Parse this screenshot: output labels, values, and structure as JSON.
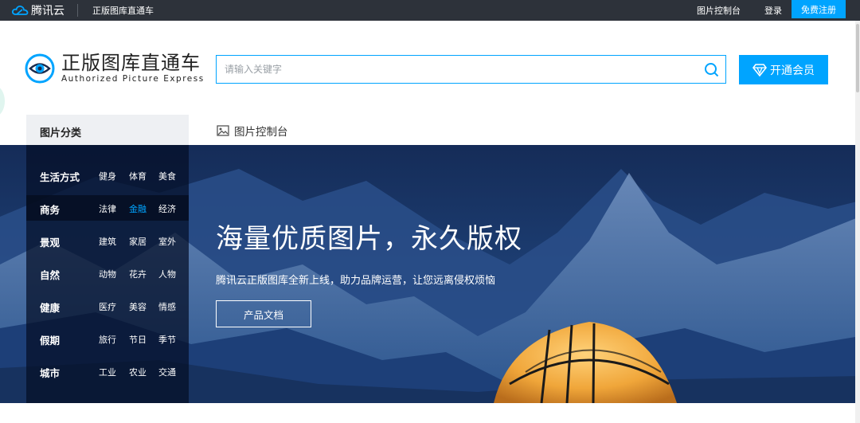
{
  "topbar": {
    "logo_text": "腾讯云",
    "product_name": "正版图库直通车",
    "console_link": "图片控制台",
    "login_link": "登录",
    "register_button": "免费注册"
  },
  "brand": {
    "title": "正版图库直通车",
    "subtitle": "Authorized Picture Express"
  },
  "search": {
    "placeholder": "请输入关键字",
    "value": ""
  },
  "vip_button": "开通会员",
  "categories": {
    "header": "图片分类",
    "rows": [
      {
        "name": "生活方式",
        "subs": [
          "健身",
          "体育",
          "美食"
        ]
      },
      {
        "name": "商务",
        "subs": [
          "法律",
          "金融",
          "经济"
        ],
        "active": true,
        "highlighted_sub": "金融"
      },
      {
        "name": "景观",
        "subs": [
          "建筑",
          "家居",
          "室外"
        ]
      },
      {
        "name": "自然",
        "subs": [
          "动物",
          "花卉",
          "人物"
        ]
      },
      {
        "name": "健康",
        "subs": [
          "医疗",
          "美容",
          "情感"
        ]
      },
      {
        "name": "假期",
        "subs": [
          "旅行",
          "节日",
          "季节"
        ]
      },
      {
        "name": "城市",
        "subs": [
          "工业",
          "农业",
          "交通"
        ]
      }
    ]
  },
  "console_tab": "图片控制台",
  "hero": {
    "title": "海量优质图片，永久版权",
    "description": "腾讯云正版图库全新上线，助力品牌运营，让您远离侵权烦恼",
    "button": "产品文档"
  },
  "colors": {
    "accent": "#00a4ff",
    "topbar_bg": "#2d323a",
    "hero_bg": "#1f4580"
  }
}
